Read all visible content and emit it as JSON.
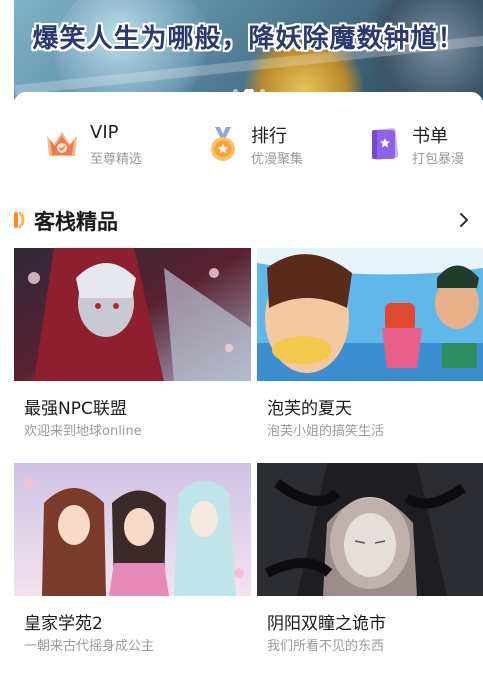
{
  "banner": {
    "caption": "爆笑人生为哪般，降妖除魔数钟馗！"
  },
  "shortcuts": [
    {
      "title": "VIP",
      "subtitle": "至尊精选",
      "icon": "crown-icon",
      "color": "#f07a4e"
    },
    {
      "title": "排行",
      "subtitle": "优漫聚集",
      "icon": "medal-icon",
      "color": "#f4a43a"
    },
    {
      "title": "书单",
      "subtitle": "打包暴漫",
      "icon": "book-icon",
      "color": "#8e63e8"
    }
  ],
  "section": {
    "title": "客栈精品",
    "accent": "#ff8a1f",
    "more_icon": "chevron-right-icon"
  },
  "comics": [
    {
      "title": "最强NPC联盟",
      "subtitle": "欢迎来到地球online"
    },
    {
      "title": "泡芙的夏天",
      "subtitle": "泡芙小姐的搞笑生活"
    },
    {
      "title": "皇家学苑2",
      "subtitle": "一朝来古代摇身成公主"
    },
    {
      "title": "阴阳双瞳之诡市",
      "subtitle": "我们所看不见的东西"
    }
  ]
}
